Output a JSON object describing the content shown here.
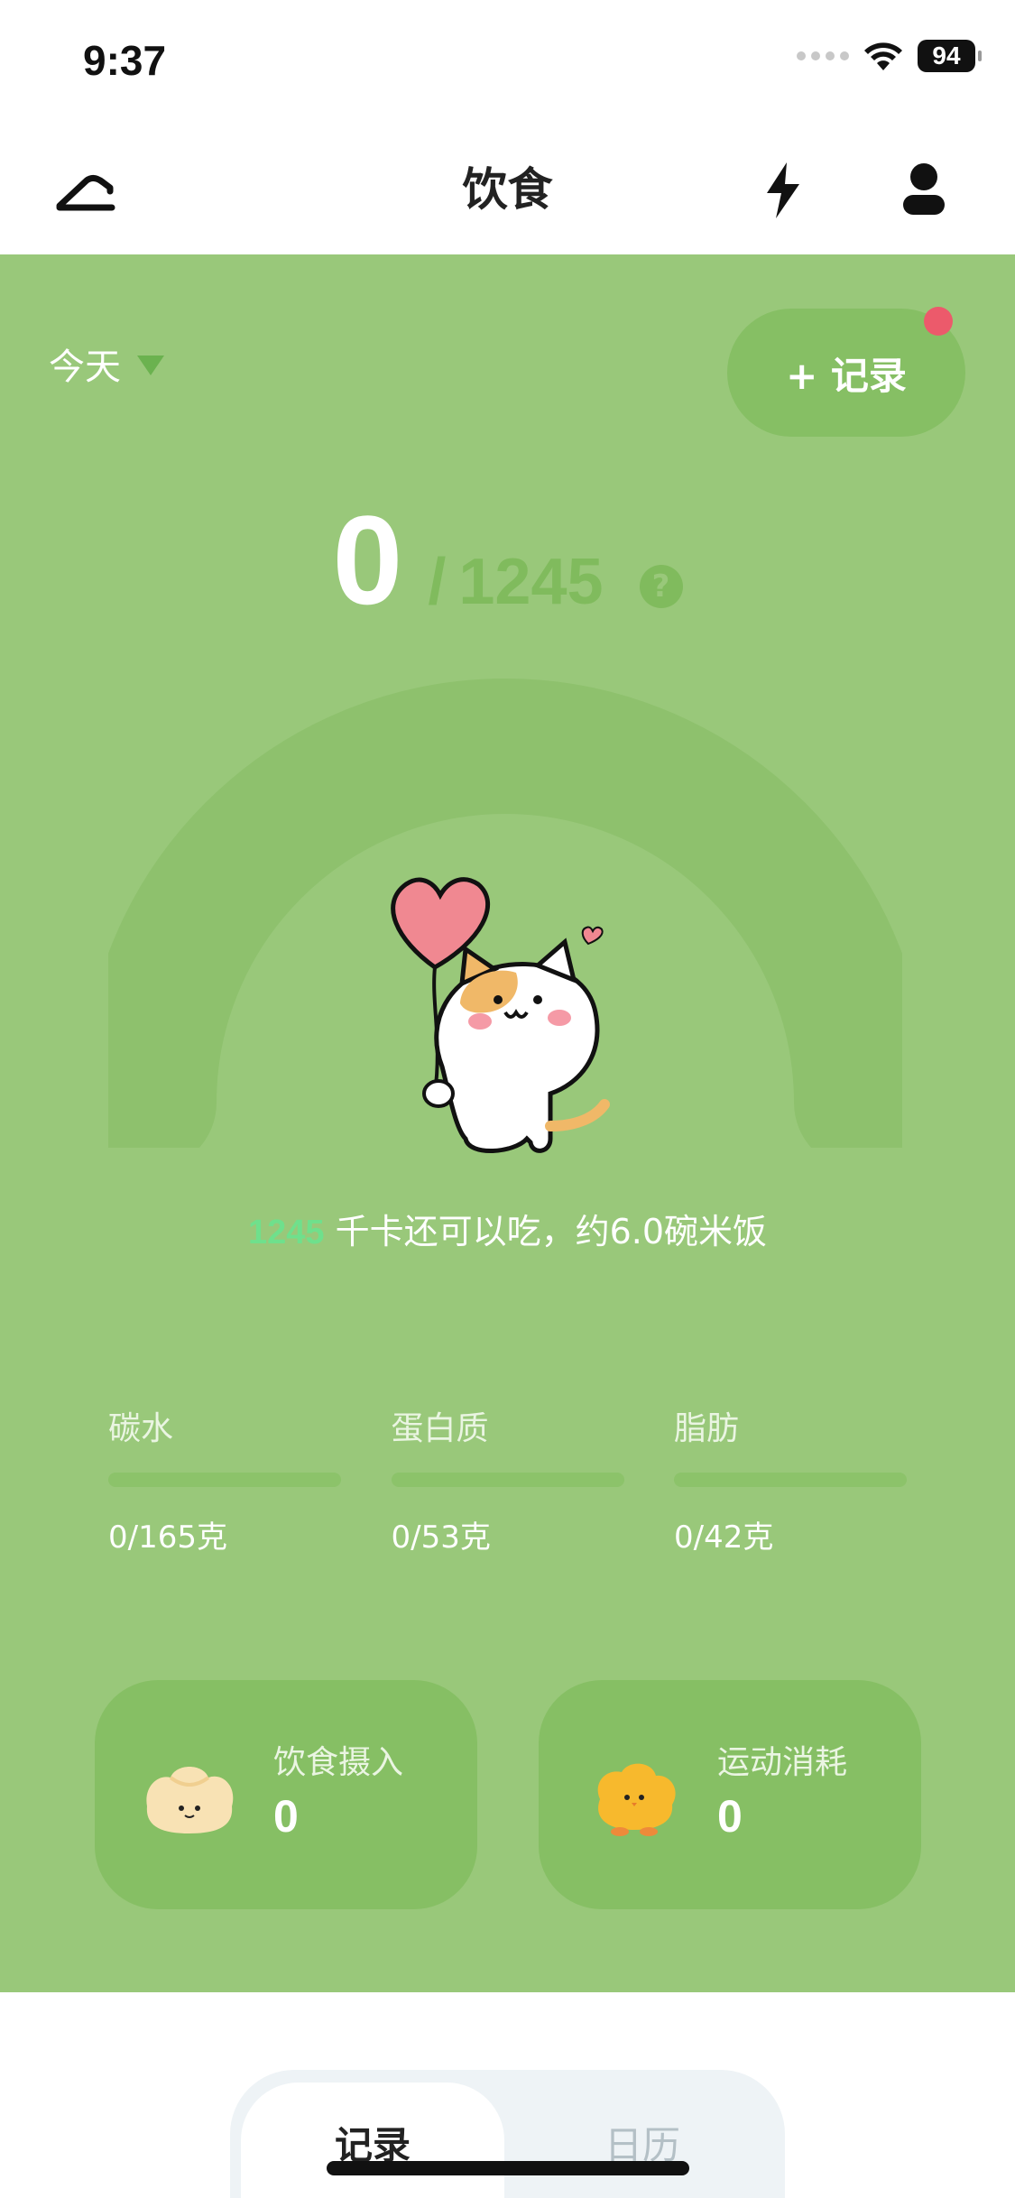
{
  "status_bar": {
    "time": "9:37",
    "battery": "94"
  },
  "nav": {
    "title": "饮食"
  },
  "panel": {
    "date_label": "今天",
    "record_button": "+ 记录",
    "calories_eaten": "0",
    "calories_separator": "/",
    "calories_goal": "1245",
    "help_symbol": "?",
    "remaining_number": "1245",
    "remaining_text": "千卡还可以吃，约6.0碗米饭"
  },
  "macros": [
    {
      "label": "碳水",
      "value": "0/165克",
      "progress": 0
    },
    {
      "label": "蛋白质",
      "value": "0/53克",
      "progress": 0
    },
    {
      "label": "脂肪",
      "value": "0/42克",
      "progress": 0
    }
  ],
  "cards": {
    "food": {
      "label": "饮食摄入",
      "value": "0"
    },
    "exercise": {
      "label": "运动消耗",
      "value": "0"
    }
  },
  "tabs": {
    "record": "记录",
    "calendar": "日历"
  },
  "colors": {
    "panel_bg": "#99c87a",
    "accent_green": "#6fe08c",
    "card_bg": "#86bf64",
    "notification_dot": "#ec5a6b"
  }
}
